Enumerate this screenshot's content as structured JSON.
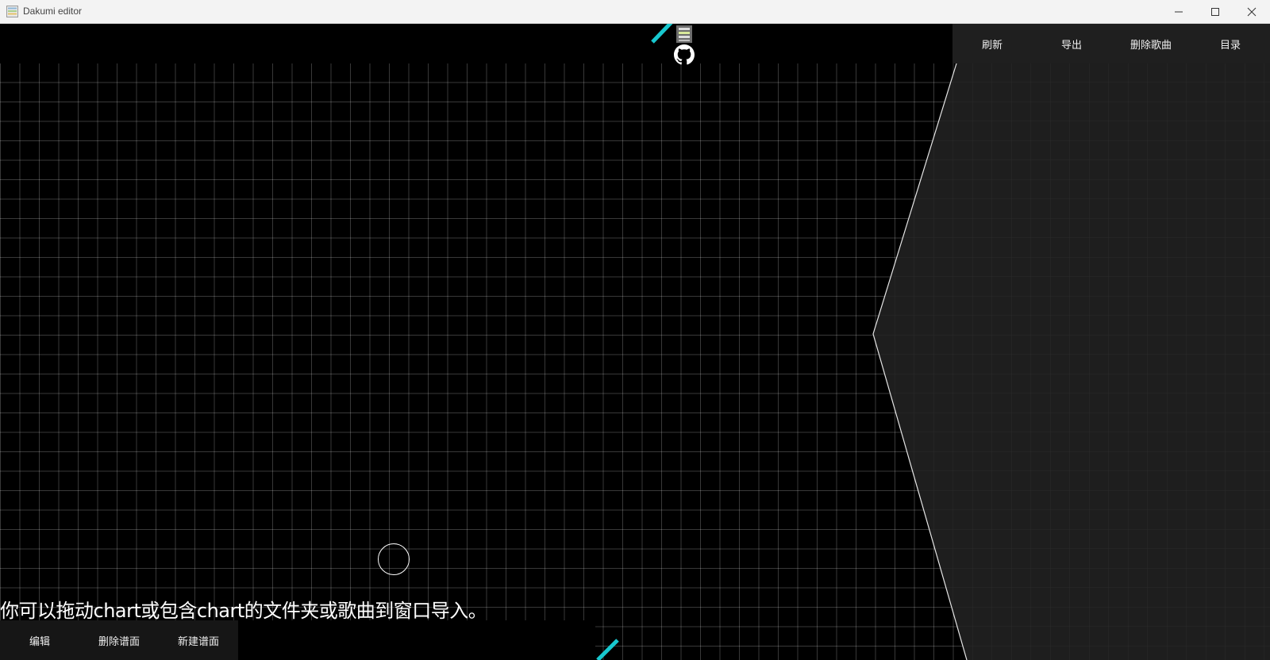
{
  "window": {
    "title": "Dakumi editor",
    "icons": [
      "app-icon",
      "minimize-icon",
      "maximize-icon",
      "close-icon"
    ]
  },
  "top_menu": {
    "items": [
      {
        "label": "刷新"
      },
      {
        "label": "导出"
      },
      {
        "label": "删除歌曲"
      },
      {
        "label": "目录"
      }
    ]
  },
  "bottom_menu": {
    "items": [
      {
        "label": "编辑"
      },
      {
        "label": "删除谱面"
      },
      {
        "label": "新建谱面"
      }
    ]
  },
  "hint": {
    "text": "你可以拖动chart或包含chart的文件夹或歌曲到窗口导入。"
  },
  "icons": {
    "database": "database-icon",
    "github": "github-icon"
  },
  "colors": {
    "accent": "#18c8cf",
    "panel": "#1f1f1f",
    "grid": "#3a3a3a",
    "background": "#000000"
  }
}
